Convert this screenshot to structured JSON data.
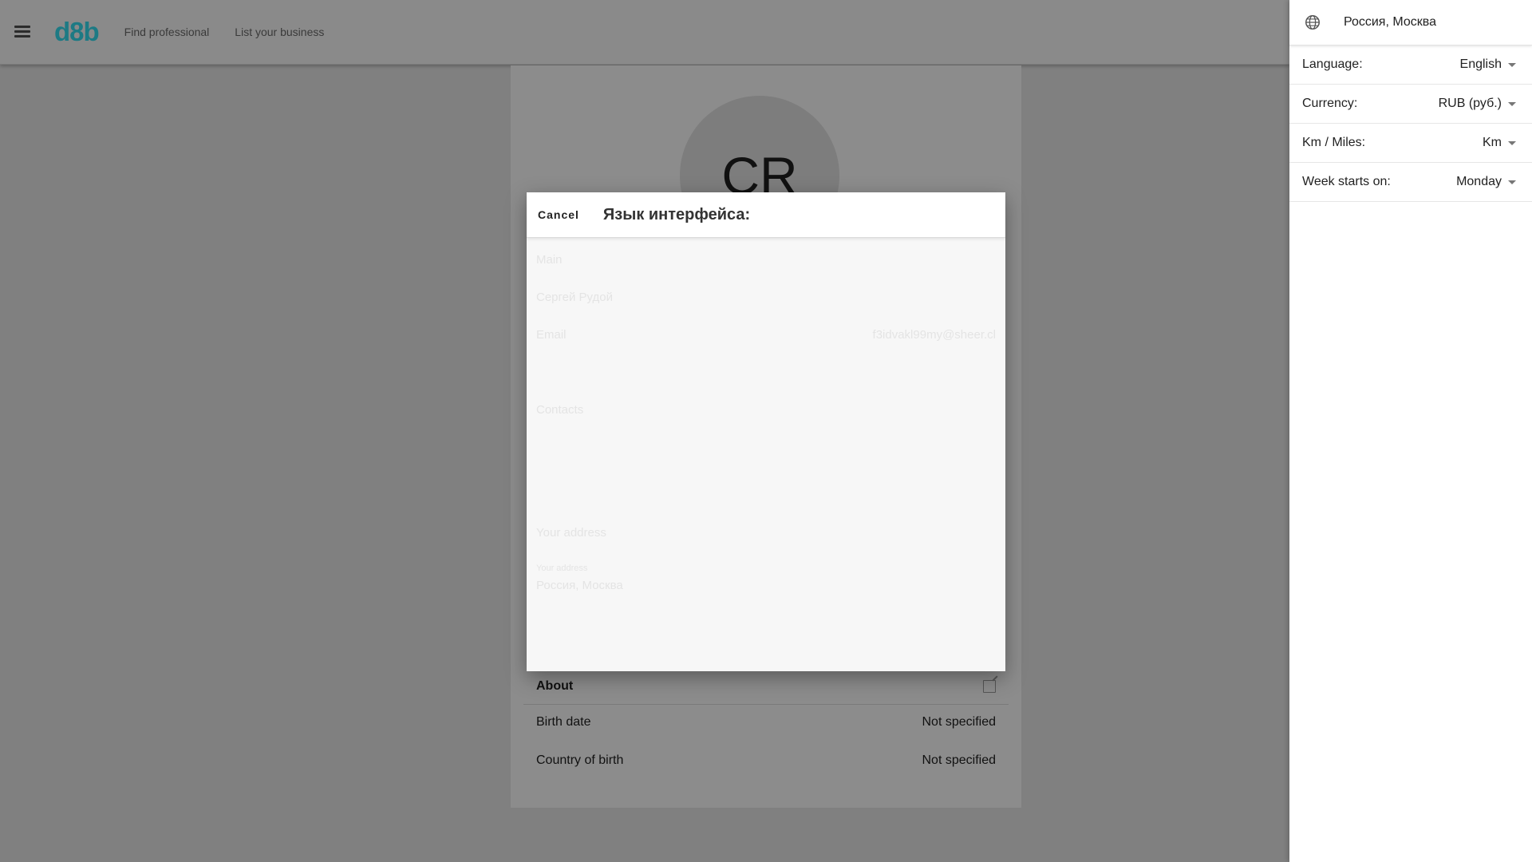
{
  "header": {
    "logo": "d8b",
    "nav": [
      "Find professional",
      "List your business"
    ]
  },
  "profile": {
    "initials": "CR",
    "sections": {
      "about": "About"
    },
    "fields": [
      {
        "label": "Birth date",
        "value": "Not specified"
      },
      {
        "label": "Country of birth",
        "value": "Not specified"
      }
    ]
  },
  "dialog": {
    "cancel": "Cancel",
    "title": "Язык интерфейса:",
    "faded": {
      "main": "Main",
      "name": "Сергей Рудой",
      "email_label": "Email",
      "email_value": "f3idvakl99my@sheer.cl",
      "contacts": "Contacts",
      "address_section": "Your address",
      "address_caption": "Your address",
      "address_value": "Россия, Москва"
    }
  },
  "settings": {
    "location": "Россия, Москва",
    "items": [
      {
        "label": "Language:",
        "value": "English"
      },
      {
        "label": "Currency:",
        "value": "RUB (руб.)"
      },
      {
        "label": "Km / Miles:",
        "value": "Km"
      },
      {
        "label": "Week starts on:",
        "value": "Monday"
      }
    ]
  },
  "colors": {
    "logo": "#1d7a84",
    "overlay": "#808080",
    "panel": "#ffffff"
  }
}
